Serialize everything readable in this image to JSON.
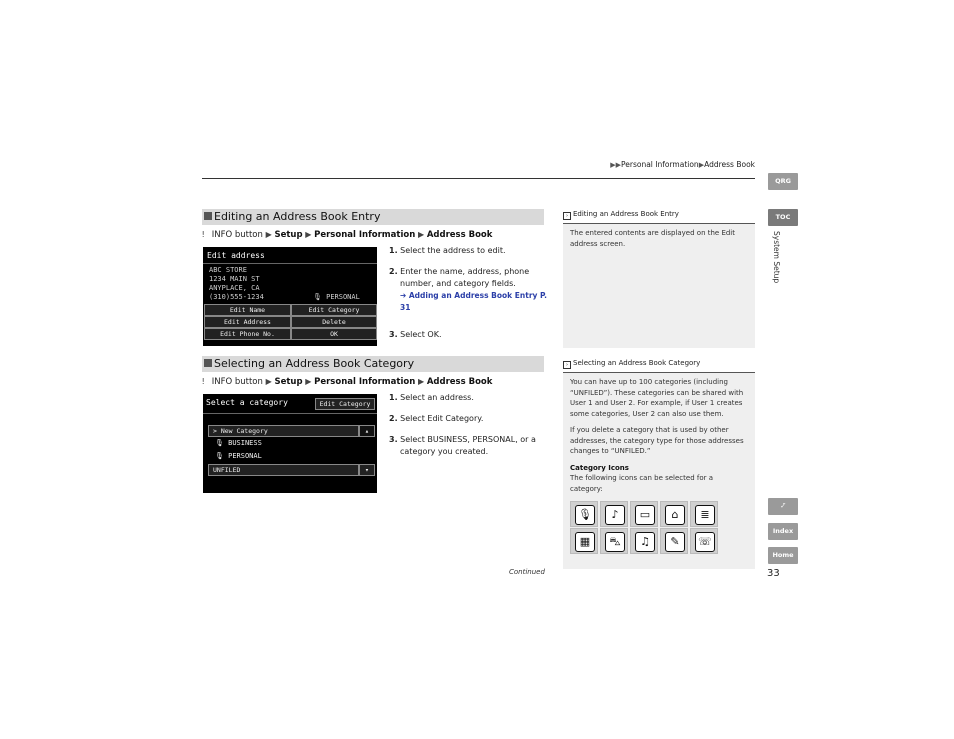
{
  "breadcrumb": {
    "arrows": "▶▶",
    "part1": "Personal Information",
    "sep": "▶",
    "part2": "Address Book"
  },
  "side_tabs": {
    "qrg": "QRG",
    "toc": "TOC",
    "section": "System Setup",
    "voice": "✓̃",
    "index": "Index",
    "home": "Home"
  },
  "page_number": "33",
  "continued": "Continued",
  "section1": {
    "title": "Editing an Address Book Entry",
    "path": {
      "p1": "INFO button",
      "p2": "Setup",
      "p3": "Personal Information",
      "p4": "Address Book"
    },
    "screen": {
      "title": "Edit address",
      "lines": [
        "ABC STORE",
        "1234 MAIN ST",
        "ANYPLACE, CA",
        "(310)555-1234"
      ],
      "category": "PERSONAL",
      "buttons": {
        "edit_name": "Edit Name",
        "edit_category": "Edit Category",
        "edit_address": "Edit Address",
        "delete": "Delete",
        "edit_phone": "Edit Phone No.",
        "ok": "OK"
      }
    },
    "steps": {
      "s1_num": "1.",
      "s1": "Select the address to edit.",
      "s2_num": "2.",
      "s2": "Enter the name, address, phone number, and category fields.",
      "s2_link": "Adding an Address Book Entry",
      "s2_page": "P. 31",
      "s3_num": "3.",
      "s3_pre": "Select ",
      "s3_bold": "OK",
      "s3_post": "."
    },
    "note": {
      "title": "Editing an Address Book Entry",
      "text": "The entered contents are displayed on the Edit address screen."
    }
  },
  "section2": {
    "title": "Selecting an Address Book Category",
    "path": {
      "p1": "INFO button",
      "p2": "Setup",
      "p3": "Personal Information",
      "p4": "Address Book"
    },
    "screen": {
      "title": "Select a category",
      "edit_btn": "Edit Category",
      "rows": {
        "new": "> New Category",
        "business": "BUSINESS",
        "personal": "PERSONAL",
        "unfiled": "UNFILED"
      }
    },
    "steps": {
      "s1_num": "1.",
      "s1": "Select an address.",
      "s2_num": "2.",
      "s2_pre": "Select ",
      "s2_bold": "Edit Category",
      "s2_post": ".",
      "s3_num": "3.",
      "s3_pre": "Select ",
      "s3_b1": "BUSINESS",
      "s3_mid": ", ",
      "s3_b2": "PERSONAL",
      "s3_post": ", or a category you created."
    },
    "note": {
      "title": "Selecting an Address Book Category",
      "p1": "You can have up to 100 categories (including “UNFILED”). These categories can be shared with User 1 and User 2. For example, if User 1 creates some categories, User 2 can also use them.",
      "p2": "If you delete a category that is used by other addresses, the category type for those addresses changes to “UNFILED.”",
      "icons_heading": "Category Icons",
      "icons_text": "The following icons can be selected for a category:"
    }
  },
  "category_icons": [
    {
      "name": "microphone-category-icon",
      "glyph": "🎙"
    },
    {
      "name": "music-category-icon",
      "glyph": "♪"
    },
    {
      "name": "folder-category-icon",
      "glyph": "▭"
    },
    {
      "name": "home-category-icon",
      "glyph": "⌂"
    },
    {
      "name": "document-category-icon",
      "glyph": "≣"
    },
    {
      "name": "store-category-icon",
      "glyph": "▦"
    },
    {
      "name": "car-category-icon",
      "glyph": "⛍"
    },
    {
      "name": "note-category-icon",
      "glyph": "♫"
    },
    {
      "name": "tools-category-icon",
      "glyph": "✎"
    },
    {
      "name": "chat-category-icon",
      "glyph": "☏"
    }
  ]
}
